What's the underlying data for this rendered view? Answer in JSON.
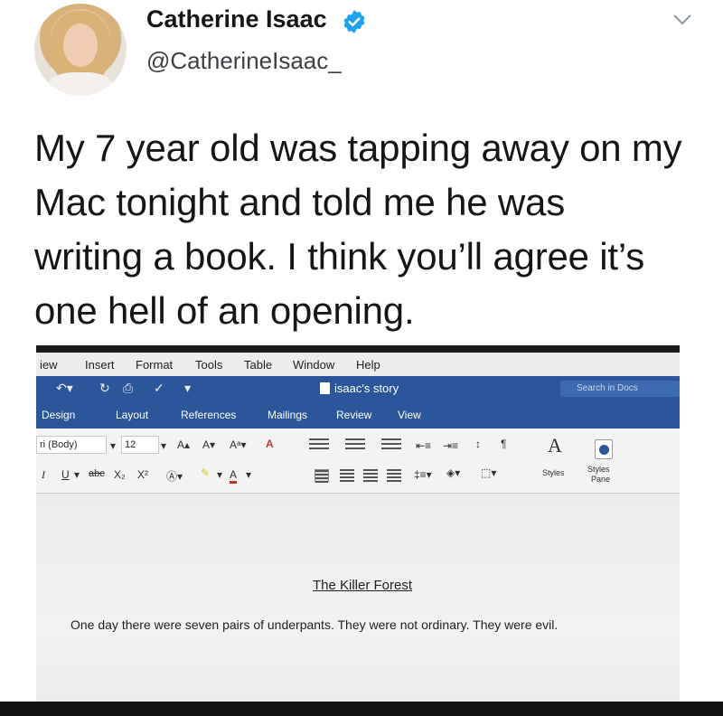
{
  "tweet": {
    "display_name": "Catherine Isaac",
    "handle": "@CatherineIsaac_",
    "text_lines": [
      "My 7 year old was tapping away on my",
      "Mac tonight and told me he was",
      "writing a book. I think you’ll agree it’s",
      "one hell of an opening."
    ],
    "verified_color": "#1da1f2"
  },
  "word": {
    "menu": [
      "iew",
      "Insert",
      "Format",
      "Tools",
      "Table",
      "Window",
      "Help"
    ],
    "doc_title": "isaac's story",
    "search_placeholder": "Search in Docs",
    "tabs": [
      "Design",
      "Layout",
      "References",
      "Mailings",
      "Review",
      "View"
    ],
    "font_name": "ri (Body)",
    "font_size": "12",
    "styles_label": "Styles",
    "styles_pane_label_1": "Styles",
    "styles_pane_label_2": "Pane",
    "accent_color": "#2b579a"
  },
  "document": {
    "title": "The Killer Forest",
    "body": "One day there were seven pairs of underpants. They were not ordinary. They were evil."
  }
}
